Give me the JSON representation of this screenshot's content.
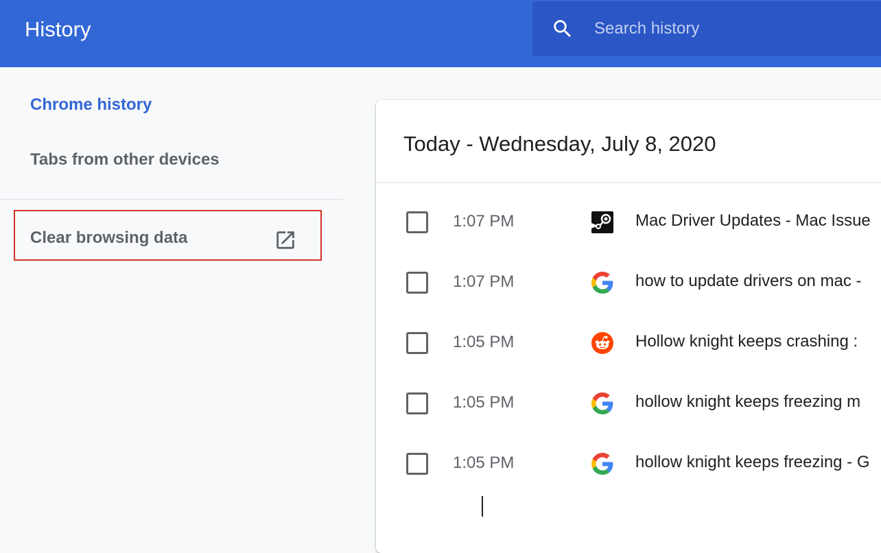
{
  "header": {
    "title": "History",
    "search_placeholder": "Search history"
  },
  "sidebar": {
    "items": [
      {
        "label": "Chrome history",
        "active": true
      },
      {
        "label": "Tabs from other devices",
        "active": false
      }
    ],
    "clear_browsing_data": {
      "label": "Clear browsing data",
      "icon": "external-link-icon",
      "highlight_color": "#d93025"
    }
  },
  "history": {
    "date_heading": "Today - Wednesday, July 8, 2020",
    "entries": [
      {
        "time": "1:07 PM",
        "favicon": "steam-icon",
        "title": "Mac Driver Updates - Mac Issue"
      },
      {
        "time": "1:07 PM",
        "favicon": "google-icon",
        "title": "how to update drivers on mac -"
      },
      {
        "time": "1:05 PM",
        "favicon": "reddit-icon",
        "title": "Hollow knight keeps crashing :"
      },
      {
        "time": "1:05 PM",
        "favicon": "google-icon",
        "title": "hollow knight keeps freezing m"
      },
      {
        "time": "1:05 PM",
        "favicon": "google-icon",
        "title": "hollow knight keeps freezing - G"
      }
    ]
  },
  "colors": {
    "toolbar": "#3367d6",
    "search_box": "#2a56c6",
    "accent": "#3367d6",
    "background": "#f8f9fa"
  }
}
